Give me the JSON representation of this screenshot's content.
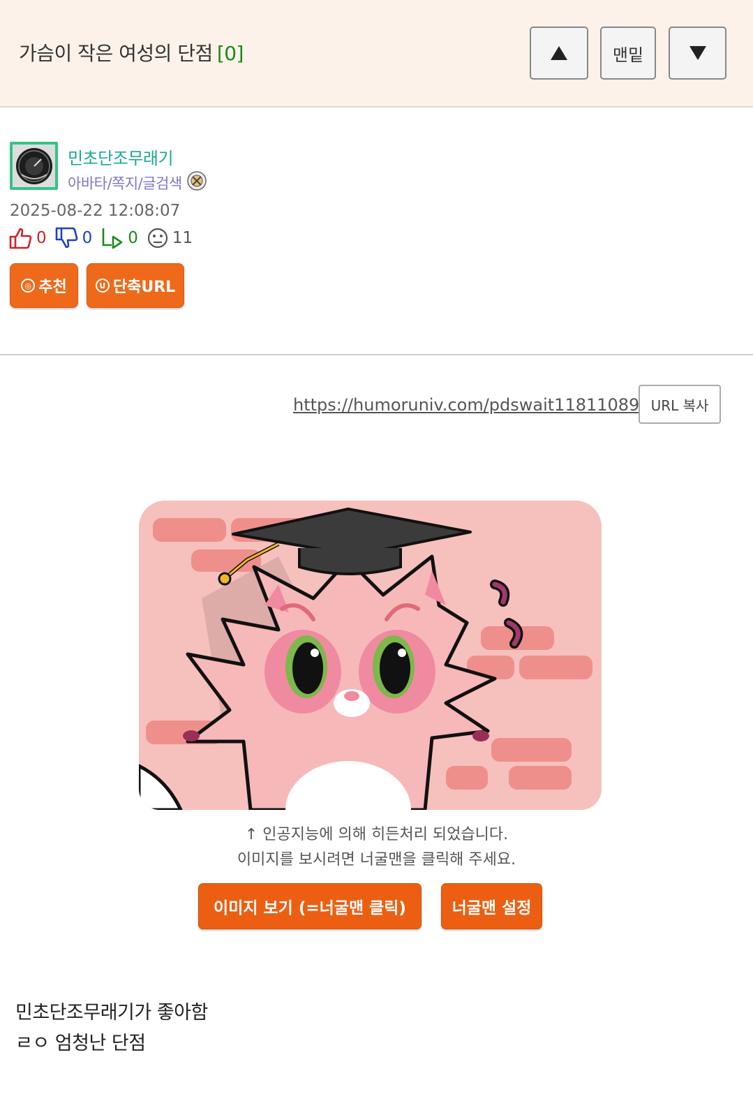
{
  "header": {
    "title": "가슴이 작은 여성의 단점",
    "comment_count": "[0]",
    "bottom_label": "맨밑"
  },
  "author": {
    "name": "민초단조무래기",
    "links": "아바타/쪽지/글검색"
  },
  "post": {
    "date": "2025-08-22 12:08:07",
    "likes": "0",
    "dislikes": "0",
    "shares": "0",
    "views": "11"
  },
  "actions": {
    "recommend": "추천",
    "short_url": "단축URL"
  },
  "share": {
    "url": "https://humoruniv.com/pdswait11811089",
    "copy_label": "URL 복사"
  },
  "hidden_image": {
    "caption_line1": "↑ 인공지능에 의해 히든처리 되었습니다.",
    "caption_line2": "이미지를 보시려면 너굴맨을 클릭해 주세요.",
    "view_button": "이미지 보기 (=너굴맨 클릭)",
    "settings_button": "너굴맨 설정"
  },
  "content": {
    "line1": "민초단조무래기가 좋아함",
    "line2": "ㄹㅇ 엄청난 단점"
  },
  "colors": {
    "accent_orange": "#ee6a1a",
    "author_teal": "#18a98e",
    "link_purple": "#7d78c8",
    "header_bg": "#fcf2ea"
  }
}
